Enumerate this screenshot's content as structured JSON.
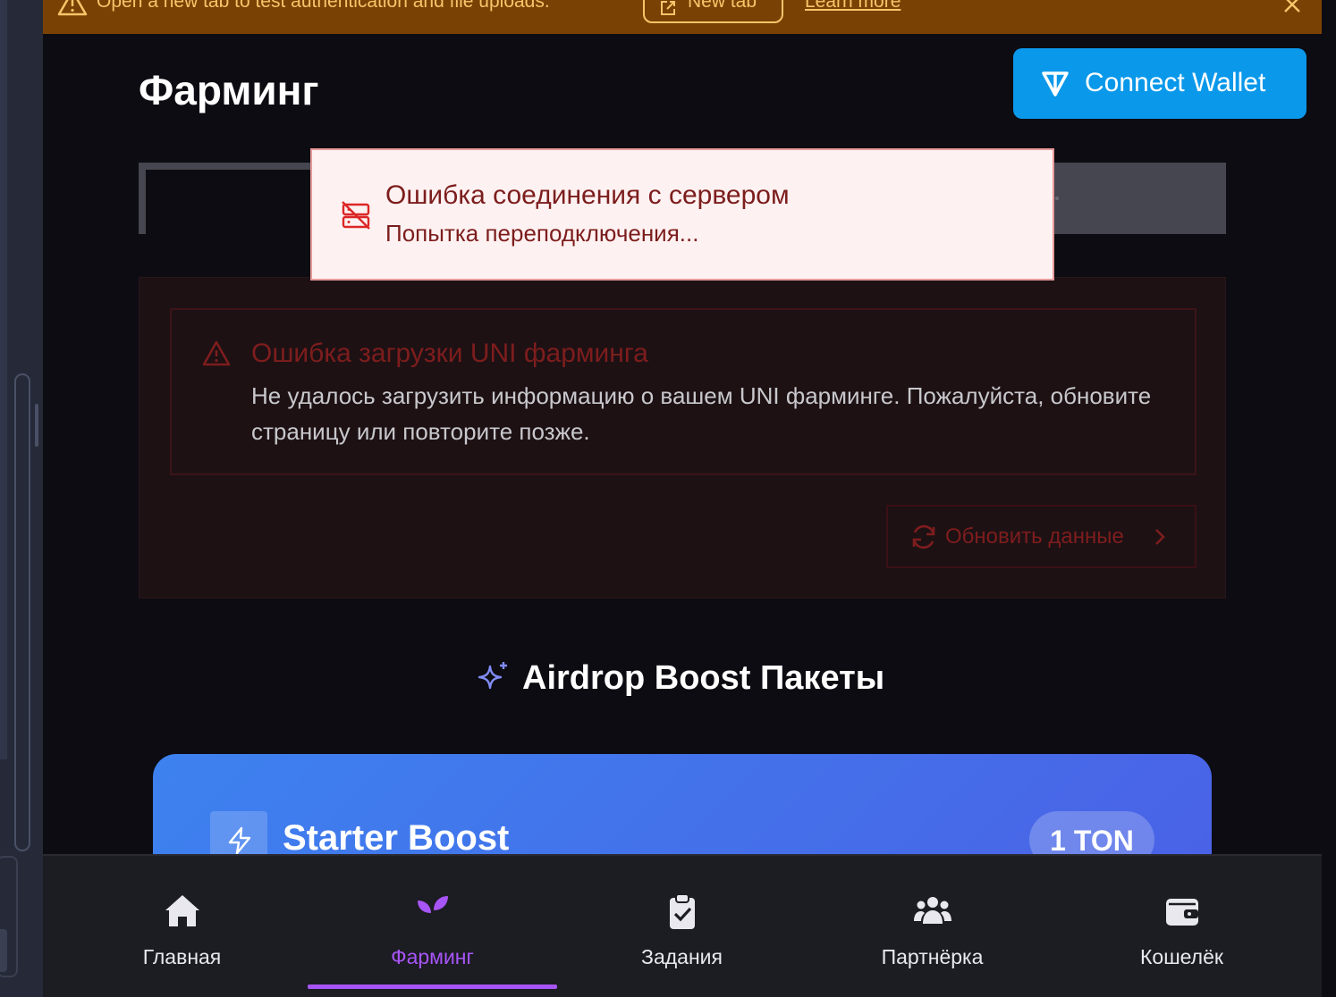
{
  "banner": {
    "text": "Open a new tab to test authentication and file uploads.",
    "new_tab_label": "New tab",
    "learn_more_label": "Learn more"
  },
  "header": {
    "title": "Фарминг",
    "connect_wallet_label": "Connect Wallet"
  },
  "toast": {
    "title": "Ошибка соединения с сервером",
    "message": "Попытка переподключения..."
  },
  "error_card": {
    "title": "Ошибка загрузки UNI фарминга",
    "description": "Не удалось загрузить информацию о вашем UNI фарминге. Пожалуйста, обновите страницу или повторите позже.",
    "refresh_label": "Обновить данные"
  },
  "boost_section": {
    "title": "Airdrop Boost Пакеты",
    "packages": [
      {
        "name": "Starter Boost",
        "price": "1 TON"
      }
    ]
  },
  "bottom_nav": {
    "items": [
      {
        "label": "Главная",
        "icon": "home-icon"
      },
      {
        "label": "Фарминг",
        "icon": "sprout-icon"
      },
      {
        "label": "Задания",
        "icon": "clipboard-check-icon"
      },
      {
        "label": "Партнёрка",
        "icon": "users-icon"
      },
      {
        "label": "Кошелёк",
        "icon": "wallet-icon"
      }
    ],
    "active_index": 1
  },
  "colors": {
    "accent_purple": "#a855f7",
    "wallet_blue": "#0a98ea",
    "banner_bg": "#7a4104",
    "error_red": "#7e1d1d"
  }
}
